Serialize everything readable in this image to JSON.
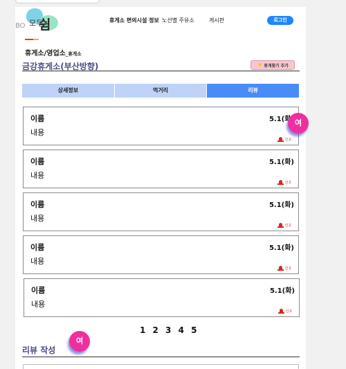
{
  "header": {
    "logo_prefix": "모두",
    "logo_main": "쉼",
    "logo_overlay": "BO",
    "nav": [
      "휴게소 편의시설 정보",
      "노선별 주유소",
      "게시판"
    ],
    "login_label": "로그인"
  },
  "breadcrumb": {
    "main": "휴게소/영업소",
    "sub": "_휴게소"
  },
  "rest_area": {
    "name": "금강휴게소(부산방향)",
    "favorite_label": "휴게찾기 추가"
  },
  "tabs": [
    {
      "label": "상세정보",
      "active": false
    },
    {
      "label": "먹거리",
      "active": false
    },
    {
      "label": "리뷰",
      "active": true
    }
  ],
  "reviews": [
    {
      "name": "이름",
      "content": "내용",
      "date": "5.1(화)",
      "report": "신고"
    },
    {
      "name": "이름",
      "content": "내용",
      "date": "5.1(화)",
      "report": "신고"
    },
    {
      "name": "이름",
      "content": "내용",
      "date": "5.1(화)",
      "report": "신고"
    },
    {
      "name": "이름",
      "content": "내용",
      "date": "5.1(화)",
      "report": "신고"
    },
    {
      "name": "이름",
      "content": "내용",
      "date": "5.1(화)",
      "report": "신고"
    }
  ],
  "pagination": "1 2 3 4 5",
  "write_section_title": "리뷰 작성",
  "fab_label": "여",
  "colors": {
    "accent": "#4a8cf7",
    "tab_inactive": "#bed3f7",
    "title": "#4a4b86",
    "login": "#1f86ff",
    "fab": "#f02ea0",
    "report": "#c0261c"
  }
}
